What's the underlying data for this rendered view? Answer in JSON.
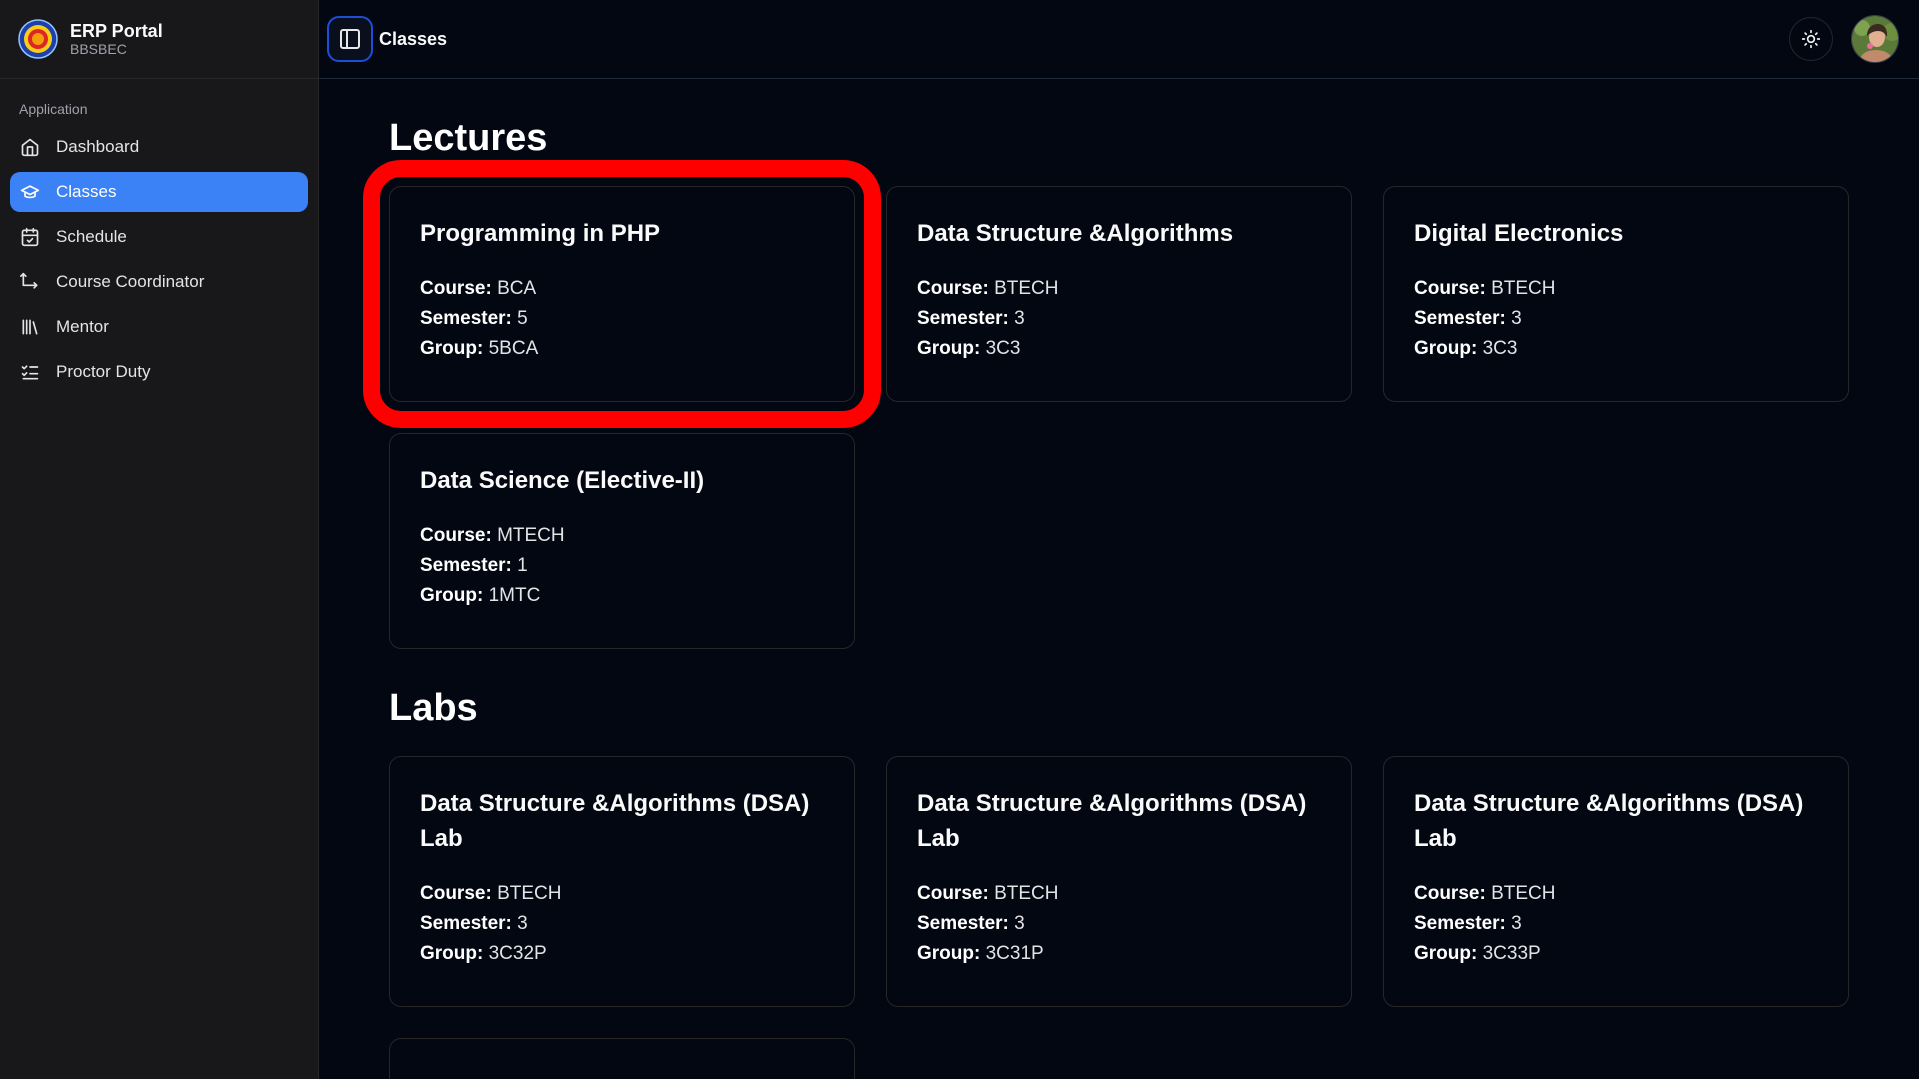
{
  "brand": {
    "title": "ERP Portal",
    "subtitle": "BBSBEC"
  },
  "sidebar": {
    "group_label": "Application",
    "items": [
      {
        "label": "Dashboard",
        "icon": "home-icon"
      },
      {
        "label": "Classes",
        "icon": "graduation-cap-icon",
        "active": true
      },
      {
        "label": "Schedule",
        "icon": "calendar-icon"
      },
      {
        "label": "Course Coordinator",
        "icon": "route-icon"
      },
      {
        "label": "Mentor",
        "icon": "library-icon"
      },
      {
        "label": "Proctor Duty",
        "icon": "list-checks-icon"
      }
    ]
  },
  "header": {
    "breadcrumb": "Classes"
  },
  "labels": {
    "course": "Course:",
    "semester": "Semester:",
    "group": "Group:"
  },
  "lectures": {
    "title": "Lectures",
    "cards": [
      {
        "title": "Programming in PHP",
        "course": "BCA",
        "semester": "5",
        "group": "5BCA"
      },
      {
        "title": "Data Structure &Algorithms",
        "course": "BTECH",
        "semester": "3",
        "group": "3C3"
      },
      {
        "title": "Digital Electronics",
        "course": "BTECH",
        "semester": "3",
        "group": "3C3"
      },
      {
        "title": "Data Science (Elective-II)",
        "course": "MTECH",
        "semester": "1",
        "group": "1MTC"
      }
    ]
  },
  "labs": {
    "title": "Labs",
    "cards": [
      {
        "title": "Data Structure &Algorithms (DSA) Lab",
        "course": "BTECH",
        "semester": "3",
        "group": "3C32P"
      },
      {
        "title": "Data Structure &Algorithms (DSA) Lab",
        "course": "BTECH",
        "semester": "3",
        "group": "3C31P"
      },
      {
        "title": "Data Structure &Algorithms (DSA) Lab",
        "course": "BTECH",
        "semester": "3",
        "group": "3C33P"
      }
    ]
  },
  "colors": {
    "accent": "#3b82f6",
    "highlight": "#ff0000",
    "background": "#030712",
    "sidebar": "#18181b"
  }
}
